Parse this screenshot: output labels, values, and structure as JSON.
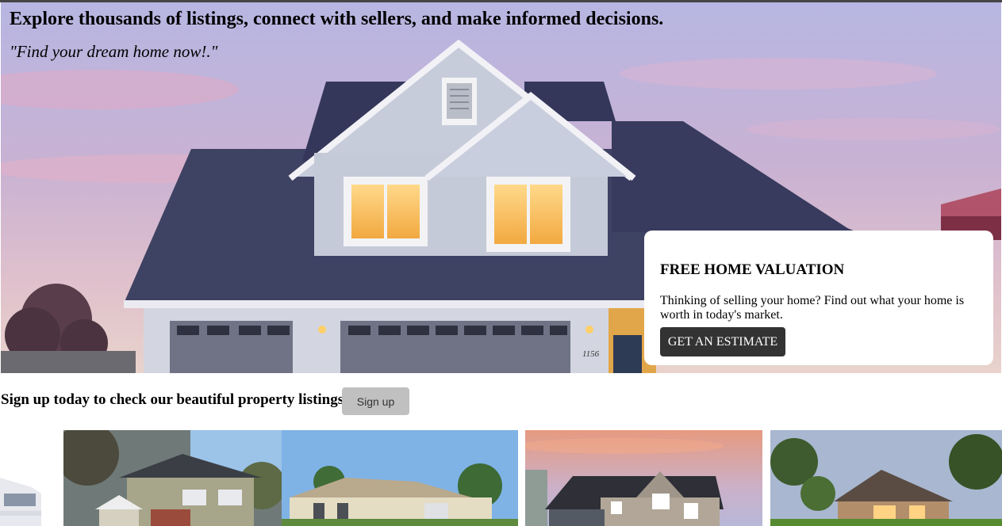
{
  "hero": {
    "title": "Explore thousands of listings, connect with sellers, and make informed decisions.",
    "quote": "\"Find your dream home now!.\"",
    "house_number": "1156"
  },
  "valuation": {
    "title": "FREE HOME VALUATION",
    "text": "Thinking of selling your home? Find out what your home is worth in today's market.",
    "button_label": "GET AN ESTIMATE"
  },
  "signup": {
    "text": "Sign up today to check our beautiful property listings",
    "button_label": "Sign up"
  },
  "listings": [
    {
      "image": "modern-white-building"
    },
    {
      "image": "two-story-suburban-house"
    },
    {
      "image": "single-story-ranch-house"
    },
    {
      "image": "gray-gabled-house-at-sunset"
    },
    {
      "image": "stone-craftsman-house"
    }
  ],
  "colors": {
    "card_background": "#ffffff",
    "estimate_button": "#333333",
    "signup_button": "#c0c0c0",
    "roof": "#3e4263",
    "siding": "#c5cad8"
  }
}
